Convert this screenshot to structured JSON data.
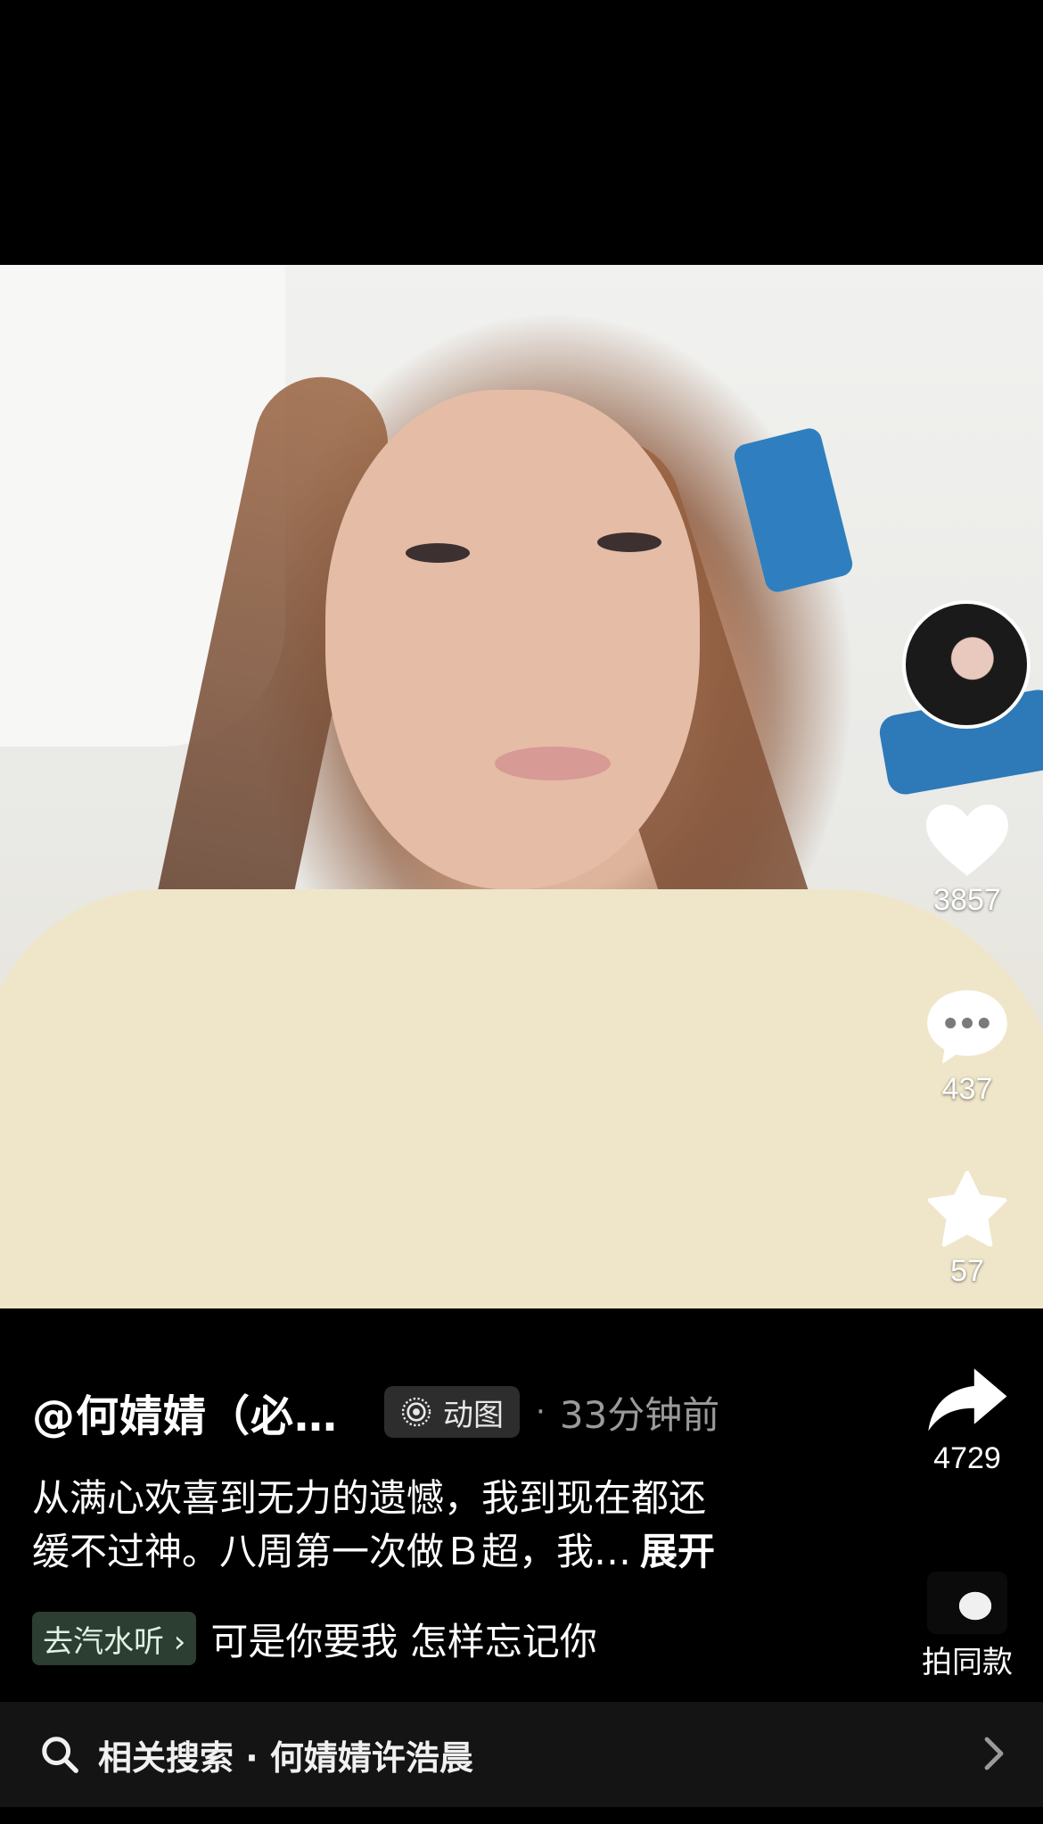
{
  "rail": {
    "likes": "3857",
    "comments": "437",
    "favorites": "57",
    "shares": "4729",
    "same_style_label": "拍同款"
  },
  "post": {
    "author": "@何婧婧（必…",
    "badge_label": "动图",
    "separator": "·",
    "time": "33分钟前",
    "caption_line1": "从满心欢喜到无力的遗憾，我到现在都还",
    "caption_line2": "缓不过神。八周第一次做Ｂ超，我…",
    "expand_label": "展开"
  },
  "music": {
    "tag_label": "去汽水听 ›",
    "song": "可是你要我 怎样忘记你"
  },
  "search": {
    "label": "相关搜索 · 何婧婧许浩晨"
  },
  "icons": [
    "heart-icon",
    "comment-icon",
    "star-icon",
    "share-icon",
    "live-photo-icon",
    "search-icon",
    "chevron-right-icon"
  ]
}
